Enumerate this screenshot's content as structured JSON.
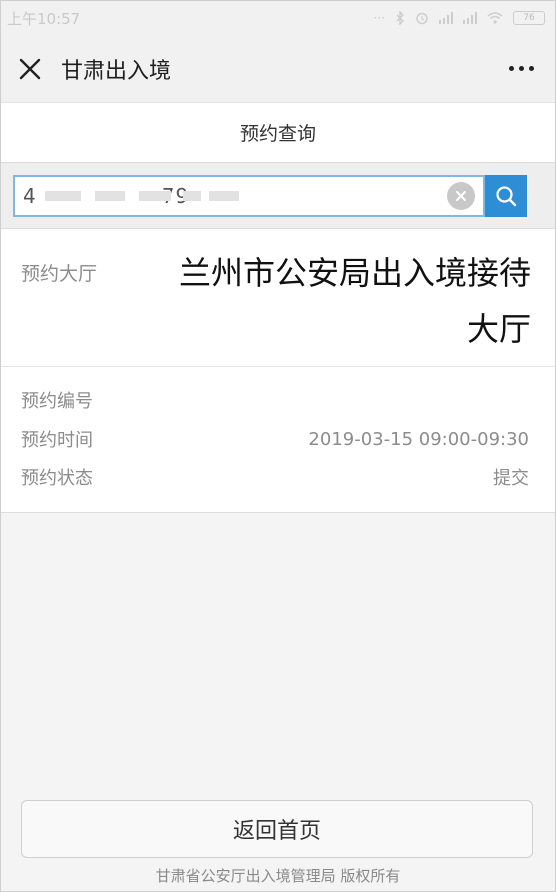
{
  "status_bar": {
    "time": "上午10:57",
    "battery": "76"
  },
  "title_bar": {
    "title": "甘肃出入境"
  },
  "page": {
    "title": "预约查询"
  },
  "search": {
    "value": "4                 79"
  },
  "result": {
    "hall_label": "预约大厅",
    "hall_value": "兰州市公安局出入境接待大厅",
    "number_label": "预约编号",
    "number_value": "",
    "time_label": "预约时间",
    "time_value": "2019-03-15 09:00-09:30",
    "status_label": "预约状态",
    "status_value": "提交"
  },
  "footer": {
    "home_button": "返回首页",
    "copyright": "甘肃省公安厅出入境管理局 版权所有"
  },
  "colors": {
    "accent": "#2d8ed6",
    "input_border": "#7fb8e0"
  }
}
